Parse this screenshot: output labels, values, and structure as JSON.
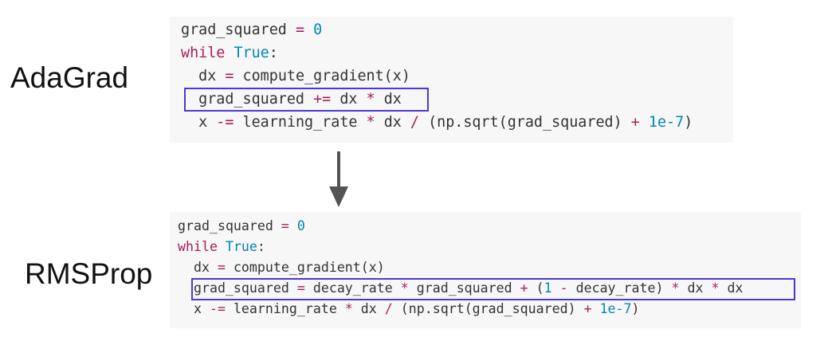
{
  "adagrad": {
    "label": "AdaGrad",
    "lines": [
      [
        {
          "t": "grad_squared ",
          "c": "plain"
        },
        {
          "t": "=",
          "c": "op"
        },
        {
          "t": " ",
          "c": "plain"
        },
        {
          "t": "0",
          "c": "num"
        }
      ],
      [
        {
          "t": "while",
          "c": "kw"
        },
        {
          "t": " ",
          "c": "plain"
        },
        {
          "t": "True",
          "c": "num"
        },
        {
          "t": ":",
          "c": "plain"
        }
      ],
      [
        {
          "t": "  dx ",
          "c": "plain"
        },
        {
          "t": "=",
          "c": "op"
        },
        {
          "t": " compute_gradient(x)",
          "c": "plain"
        }
      ],
      [
        {
          "t": "  grad_squared ",
          "c": "plain"
        },
        {
          "t": "+=",
          "c": "op"
        },
        {
          "t": " dx ",
          "c": "plain"
        },
        {
          "t": "*",
          "c": "op"
        },
        {
          "t": " dx",
          "c": "plain"
        }
      ],
      [
        {
          "t": "  x ",
          "c": "plain"
        },
        {
          "t": "-=",
          "c": "op"
        },
        {
          "t": " learning_rate ",
          "c": "plain"
        },
        {
          "t": "*",
          "c": "op"
        },
        {
          "t": " dx ",
          "c": "plain"
        },
        {
          "t": "/",
          "c": "op"
        },
        {
          "t": " (np.sqrt(grad_squared) ",
          "c": "plain"
        },
        {
          "t": "+",
          "c": "op"
        },
        {
          "t": " ",
          "c": "plain"
        },
        {
          "t": "1e-7",
          "c": "num"
        },
        {
          "t": ")",
          "c": "plain"
        }
      ]
    ]
  },
  "rmsprop": {
    "label": "RMSProp",
    "lines": [
      [
        {
          "t": "grad_squared ",
          "c": "plain"
        },
        {
          "t": "=",
          "c": "op"
        },
        {
          "t": " ",
          "c": "plain"
        },
        {
          "t": "0",
          "c": "num"
        }
      ],
      [
        {
          "t": "while",
          "c": "kw"
        },
        {
          "t": " ",
          "c": "plain"
        },
        {
          "t": "True",
          "c": "num"
        },
        {
          "t": ":",
          "c": "plain"
        }
      ],
      [
        {
          "t": "  dx ",
          "c": "plain"
        },
        {
          "t": "=",
          "c": "op"
        },
        {
          "t": " compute_gradient(x)",
          "c": "plain"
        }
      ],
      [
        {
          "t": "  grad_squared ",
          "c": "plain"
        },
        {
          "t": "=",
          "c": "op"
        },
        {
          "t": " decay_rate ",
          "c": "plain"
        },
        {
          "t": "*",
          "c": "op"
        },
        {
          "t": " grad_squared ",
          "c": "plain"
        },
        {
          "t": "+",
          "c": "op"
        },
        {
          "t": " (",
          "c": "plain"
        },
        {
          "t": "1",
          "c": "num"
        },
        {
          "t": " ",
          "c": "plain"
        },
        {
          "t": "-",
          "c": "op"
        },
        {
          "t": " decay_rate) ",
          "c": "plain"
        },
        {
          "t": "*",
          "c": "op"
        },
        {
          "t": " dx ",
          "c": "plain"
        },
        {
          "t": "*",
          "c": "op"
        },
        {
          "t": " dx",
          "c": "plain"
        }
      ],
      [
        {
          "t": "  x ",
          "c": "plain"
        },
        {
          "t": "-=",
          "c": "op"
        },
        {
          "t": " learning_rate ",
          "c": "plain"
        },
        {
          "t": "*",
          "c": "op"
        },
        {
          "t": " dx ",
          "c": "plain"
        },
        {
          "t": "/",
          "c": "op"
        },
        {
          "t": " (np.sqrt(grad_squared) ",
          "c": "plain"
        },
        {
          "t": "+",
          "c": "op"
        },
        {
          "t": " ",
          "c": "plain"
        },
        {
          "t": "1e-7",
          "c": "num"
        },
        {
          "t": ")",
          "c": "plain"
        }
      ]
    ]
  },
  "colors": {
    "keyword": "#a71d5d",
    "number": "#0086b3",
    "operator": "#a71d5d",
    "text": "#333333",
    "code_background": "#f7f7f7",
    "highlight_border": "#4a37d6",
    "arrow": "#555555"
  },
  "icons": {
    "transition": "down-arrow-icon"
  }
}
